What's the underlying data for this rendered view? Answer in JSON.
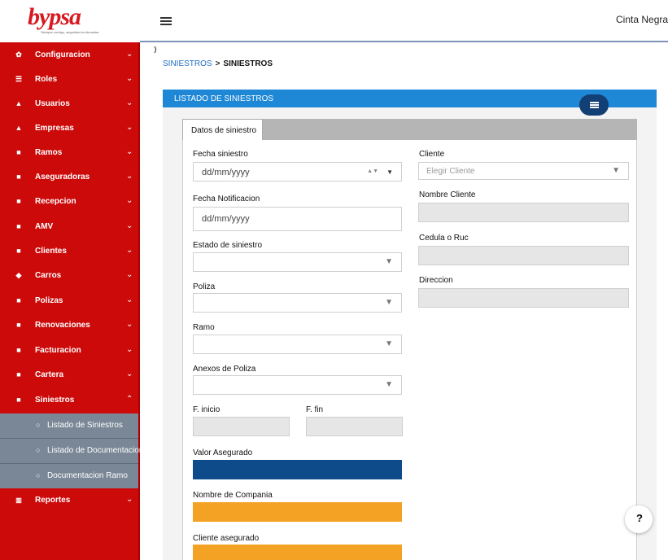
{
  "brand": {
    "logo_text": "bypsa",
    "tagline": "Siempre contigo, seguridad es bienestar"
  },
  "header": {
    "user_name": "Cinta Negra"
  },
  "sidebar": {
    "items": [
      {
        "label": "Configuracion",
        "icon": "gear-icon"
      },
      {
        "label": "Roles",
        "icon": "list-icon"
      },
      {
        "label": "Usuarios",
        "icon": "user-icon"
      },
      {
        "label": "Empresas",
        "icon": "user-icon"
      },
      {
        "label": "Ramos",
        "icon": "document-icon"
      },
      {
        "label": "Aseguradoras",
        "icon": "document-icon"
      },
      {
        "label": "Recepcion",
        "icon": "document-icon"
      },
      {
        "label": "AMV",
        "icon": "document-icon"
      },
      {
        "label": "Clientes",
        "icon": "document-icon"
      },
      {
        "label": "Carros",
        "icon": "car-icon"
      },
      {
        "label": "Polizas",
        "icon": "document-icon"
      },
      {
        "label": "Renovaciones",
        "icon": "file-icon"
      },
      {
        "label": "Facturacion",
        "icon": "document-icon"
      },
      {
        "label": "Cartera",
        "icon": "document-icon"
      },
      {
        "label": "Siniestros",
        "icon": "document-icon"
      }
    ],
    "subitems": [
      {
        "label": "Listado de Siniestros"
      },
      {
        "label": "Listado de Documentacion"
      },
      {
        "label": "Documentacion Ramo"
      }
    ],
    "reportes": {
      "label": "Reportes",
      "icon": "bar-chart-icon"
    }
  },
  "breadcrumb": {
    "parent": "SINIESTROS",
    "separator": ">",
    "current": "SINIESTROS"
  },
  "panel": {
    "title": "LISTADO DE SINIESTROS"
  },
  "tabs": [
    {
      "label": "Datos de siniestro"
    }
  ],
  "form": {
    "fecha_siniestro": {
      "label": "Fecha siniestro",
      "placeholder": "dd/mm/yyyy"
    },
    "fecha_notificacion": {
      "label": "Fecha Notificacion",
      "placeholder": "dd/mm/yyyy"
    },
    "estado": {
      "label": "Estado de siniestro"
    },
    "poliza": {
      "label": "Poliza"
    },
    "ramo": {
      "label": "Ramo"
    },
    "anexos": {
      "label": "Anexos de Poliza"
    },
    "f_inicio": {
      "label": "F. inicio"
    },
    "f_fin": {
      "label": "F. fin"
    },
    "valor_asegurado": {
      "label": "Valor Asegurado"
    },
    "nombre_compania": {
      "label": "Nombre de Compania"
    },
    "cliente_asegurado": {
      "label": "Cliente asegurado"
    },
    "cliente": {
      "label": "Cliente",
      "placeholder": "Elegir Cliente"
    },
    "nombre_cliente": {
      "label": "Nombre Cliente"
    },
    "cedula": {
      "label": "Cedula o Ruc"
    },
    "direccion": {
      "label": "Direccion"
    }
  },
  "help": {
    "label": "?"
  },
  "colors": {
    "sidebar": "#cc0a0a",
    "panel_header": "#1e87d6",
    "valor_field": "#0d4b8a",
    "compania_field": "#f4a223"
  }
}
